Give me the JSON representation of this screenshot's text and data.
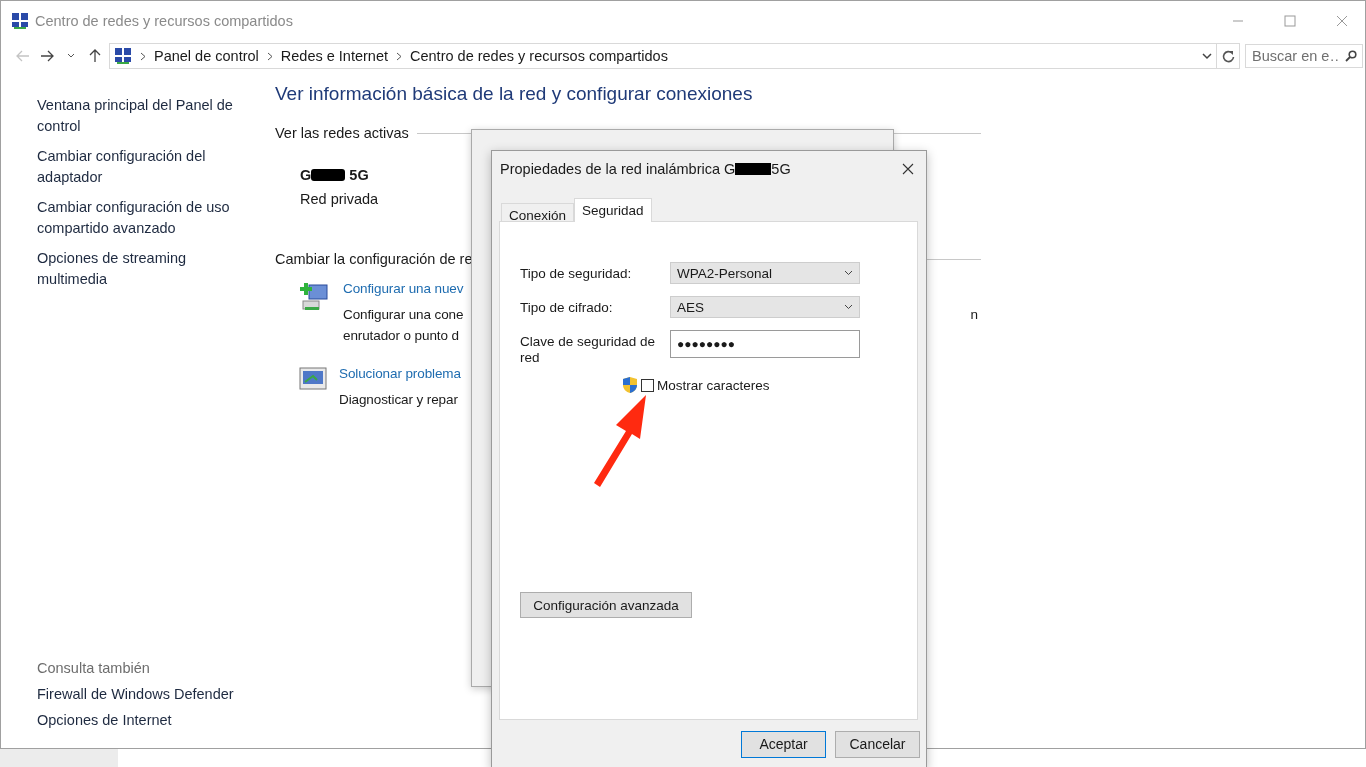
{
  "window": {
    "title": "Centro de redes y recursos compartidos"
  },
  "navigation": {
    "breadcrumbs": [
      "Panel de control",
      "Redes e Internet",
      "Centro de redes y recursos compartidos"
    ],
    "search": {
      "placeholder": "Buscar en e…"
    }
  },
  "sidebar": {
    "links": [
      "Ventana principal del Panel de control",
      "Cambiar configuración del adaptador",
      "Cambiar configuración de uso compartido avanzado",
      "Opciones de streaming multimedia"
    ],
    "see_also": {
      "heading": "Consulta también",
      "links": [
        "Firewall de Windows Defender",
        "Opciones de Internet"
      ]
    }
  },
  "main": {
    "heading": "Ver información básica de la red y configurar conexiones",
    "active_networks": {
      "label": "Ver las redes activas",
      "network": {
        "name_start": "G",
        "name_end": "5G",
        "type": "Red privada"
      }
    },
    "change_settings": {
      "label": "Cambiar la configuración de re",
      "tasks": [
        {
          "title": "Configurar una nuev",
          "lines": [
            "Configurar una cone",
            "enrutador o punto d"
          ],
          "overflow": "n"
        },
        {
          "title": "Solucionar problema",
          "lines": [
            "Diagnosticar y repar"
          ]
        }
      ]
    }
  },
  "dialog": {
    "title_start": "Propiedades de la red inalámbrica G",
    "title_end": "5G",
    "tabs": [
      {
        "label": "Conexión",
        "selected": false
      },
      {
        "label": "Seguridad",
        "selected": true
      }
    ],
    "fields": [
      {
        "kind": "dropdown",
        "label": "Tipo de seguridad:",
        "value": "WPA2-Personal"
      },
      {
        "kind": "dropdown",
        "label": "Tipo de cifrado:",
        "value": "AES"
      },
      {
        "kind": "password",
        "label": "Clave de seguridad de red",
        "value": "●●●●●●●●"
      }
    ],
    "show_characters": {
      "label": "Mostrar caracteres",
      "checked": false
    },
    "advanced_button": "Configuración avanzada",
    "buttons": [
      {
        "label": "Aceptar",
        "default": true
      },
      {
        "label": "Cancelar",
        "default": false
      }
    ]
  }
}
